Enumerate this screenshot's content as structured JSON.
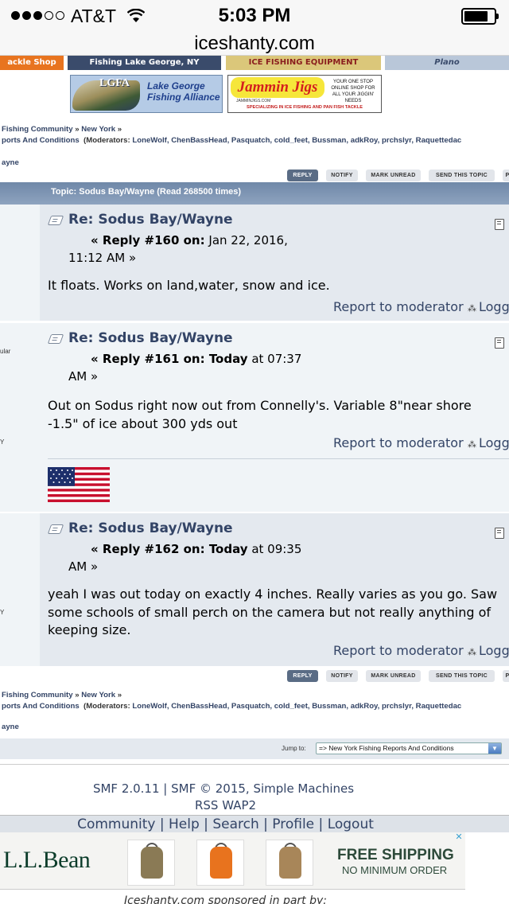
{
  "status": {
    "carrier": "AT&T",
    "time": "5:03 PM",
    "url": "iceshanty.com"
  },
  "banners": {
    "tackle": "ackle Shop",
    "fishing": "Fishing Lake George, NY",
    "equipment": "ICE FISHING EQUIPMENT",
    "other": "Plano",
    "lgfa_abbr": "LGFA",
    "lgfa_name_l1": "Lake George",
    "lgfa_name_l2": "Fishing Alliance",
    "jammin_logo": "Jammin Jigs",
    "jammin_url": "JAMMINJIGS.COM",
    "jammin_tag": "YOUR ONE STOP ONLINE SHOP FOR ALL YOUR JIGGIN' NEEDS",
    "jammin_spec": "SPECIALIZING IN ICE FISHING AND PAN FISH TACKLE"
  },
  "breadcrumb": {
    "community": "Fishing Community",
    "sep": "»",
    "state": "New York",
    "board": "ports And Conditions",
    "mods_label": "(Moderators:",
    "mods": "LoneWolf, ChenBassHead, Pasquatch, cold_feet, Bussman, adkRoy, prchslyr, Raquettedac",
    "topic": "ayne"
  },
  "buttons": {
    "reply": "REPLY",
    "notify": "NOTIFY",
    "mark_unread": "MARK UNREAD",
    "send_topic": "SEND THIS TOPIC",
    "more": "P"
  },
  "topic_header": "Topic: Sodus Bay/Wayne  (Read 268500 times)",
  "posts": [
    {
      "title": "Re: Sodus Bay/Wayne",
      "reply_prefix": "« Reply #160 on:",
      "date": "Jan 22, 2016,",
      "time_line": "11:12 AM »",
      "text": "It floats.  Works on land,water, snow and ice.",
      "report": "Report to moderator",
      "logged": "Logg",
      "poster_frag": ""
    },
    {
      "title": "Re: Sodus Bay/Wayne",
      "reply_prefix": "« Reply #161 on: Today",
      "date": "at 07:37",
      "time_line": "AM »",
      "text": "Out on Sodus right now out from Connelly's. Variable 8\"near shore -1.5\" of ice about 300 yds out",
      "report": "Report to moderator",
      "logged": "Logg",
      "poster_frag": "ular",
      "poster_frag2": "Y"
    },
    {
      "title": "Re: Sodus Bay/Wayne",
      "reply_prefix": "« Reply #162 on: Today",
      "date": "at 09:35",
      "time_line": "AM »",
      "text": "yeah I was out today on exactly 4 inches.  Really varies as you go. Saw some schools of small perch on the camera but not really anything of keeping size.",
      "report": "Report to moderator",
      "logged": "Logg",
      "poster_frag": "Y"
    }
  ],
  "jump": {
    "label": "Jump to:",
    "selected": "=> New York Fishing Reports And Conditions"
  },
  "footer": {
    "line1": "SMF 2.0.11 | SMF © 2015, Simple Machines",
    "rss": "RSS",
    "wap2": "WAP2",
    "nav": [
      "Community",
      "Help",
      "Search",
      "Profile",
      "Logout"
    ]
  },
  "ad": {
    "brand": "L.L.Bean",
    "shipping": "FREE SHIPPING",
    "minimum": "NO MINIMUM ORDER",
    "close": "✕"
  },
  "sponsor": "Iceshanty.com sponsored in part by:",
  "colors": {
    "accent": "#334466",
    "header": "#6f88a8",
    "post_bg": "#e4e9ef"
  }
}
